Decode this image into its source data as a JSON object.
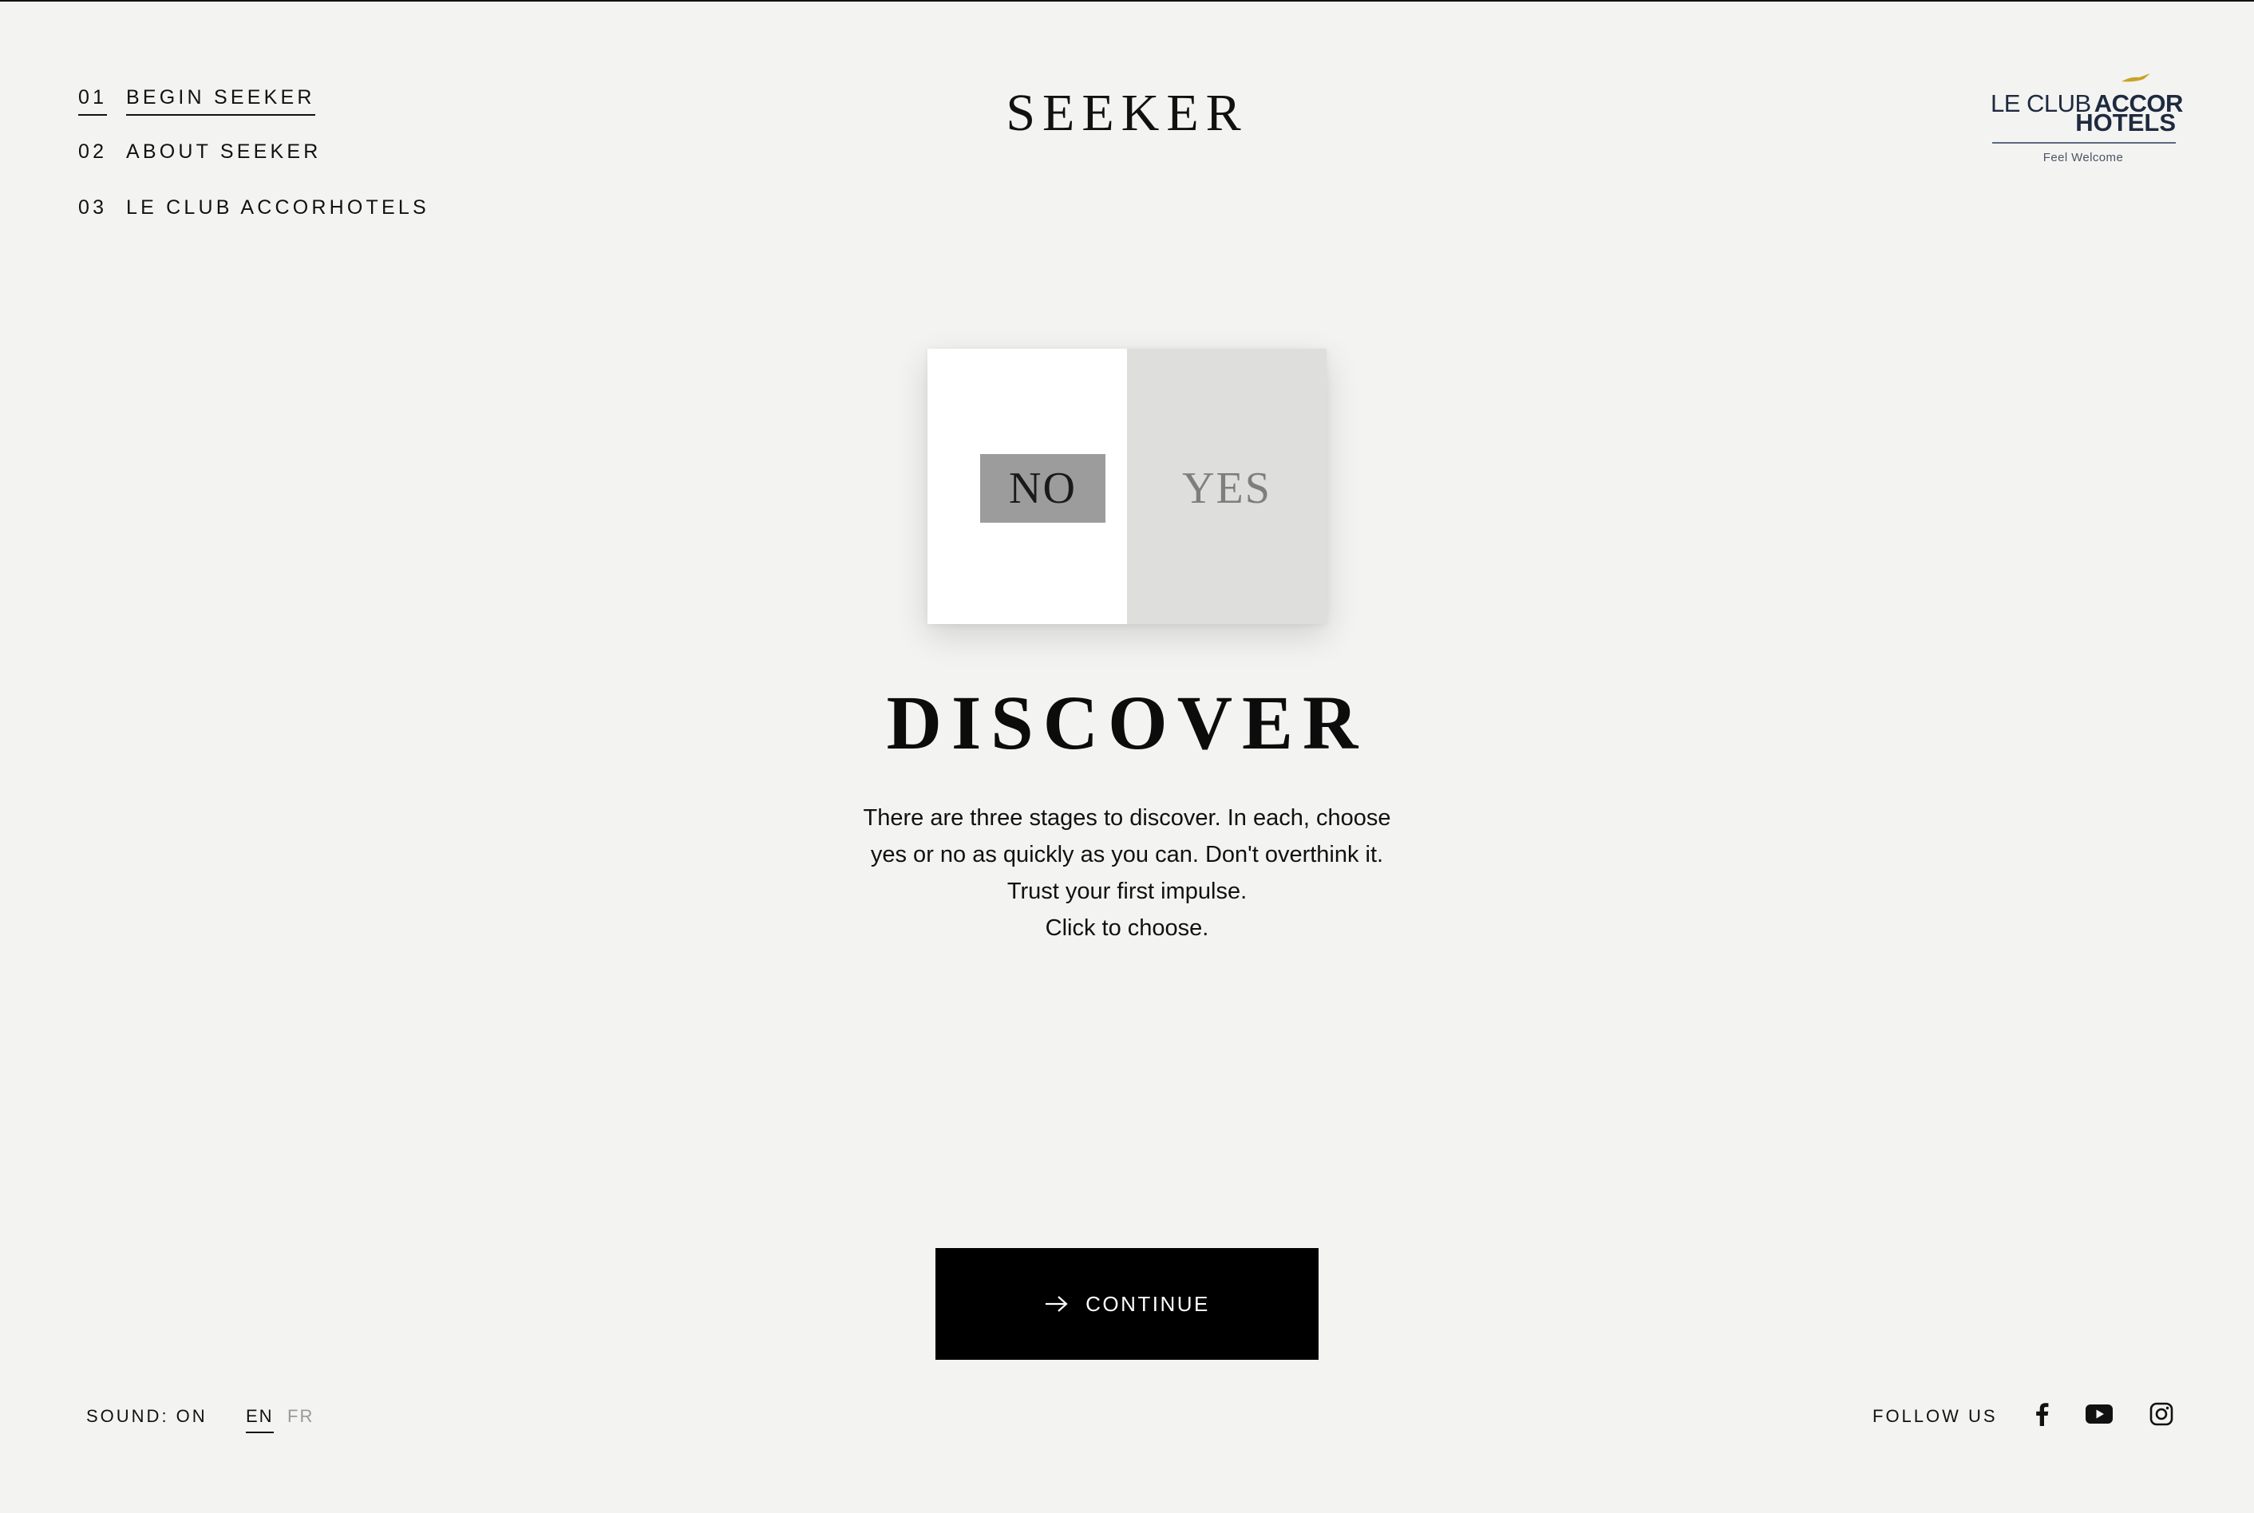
{
  "nav": {
    "items": [
      {
        "number": "01",
        "label": "BEGIN SEEKER",
        "active": true
      },
      {
        "number": "02",
        "label": "ABOUT SEEKER",
        "active": false
      },
      {
        "number": "03",
        "label": "LE CLUB ACCORHOTELS",
        "active": false
      }
    ]
  },
  "brand": {
    "title": "SEEKER"
  },
  "partner": {
    "line1_light": "LE CLUB",
    "line1_bold": "ACCOR",
    "line2": "HOTELS",
    "tagline": "Feel Welcome",
    "brand_color": "#1e2a3f",
    "accent_color": "#c9a227"
  },
  "card": {
    "no_label": "NO",
    "yes_label": "YES"
  },
  "main": {
    "heading": "DISCOVER",
    "body_lines": [
      "There are three stages to discover. In each, choose",
      "yes or no as quickly as you can. Don't overthink it.",
      "Trust your first impulse.",
      "Click to choose."
    ]
  },
  "cta": {
    "label": "CONTINUE",
    "icon": "arrow-right-icon"
  },
  "footer": {
    "sound_label": "SOUND: ON",
    "languages": [
      {
        "code": "EN",
        "active": true
      },
      {
        "code": "FR",
        "active": false
      }
    ],
    "follow_label": "FOLLOW US",
    "social": [
      "facebook-icon",
      "youtube-icon",
      "instagram-icon"
    ]
  }
}
